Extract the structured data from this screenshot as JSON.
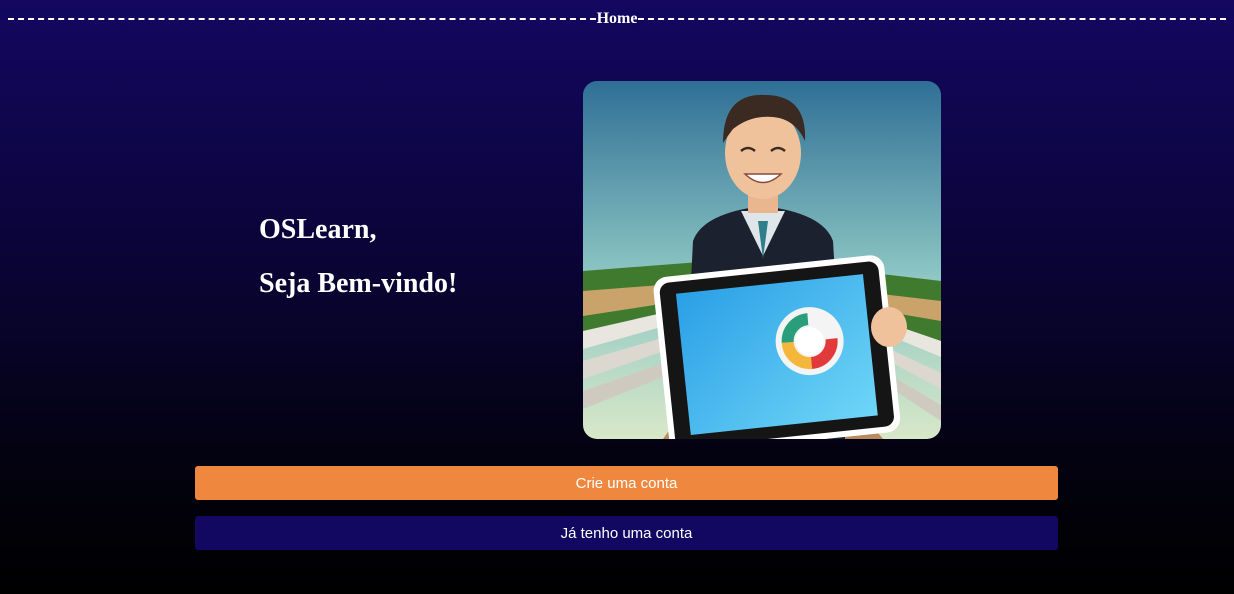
{
  "header": {
    "title": "Home"
  },
  "welcome": {
    "line1": "OSLearn,",
    "line2": "Seja Bem-vindo!"
  },
  "hero": {
    "icon": "hero-illustration-icon",
    "description_subject": "man-holding-tablet"
  },
  "actions": {
    "create_account_label": "Crie uma conta",
    "login_label": "Já tenho uma conta"
  },
  "colors": {
    "background_top": "#130760",
    "background_bottom": "#000000",
    "create_button": "#ef883e",
    "login_button": "#120861",
    "text": "#ffffff"
  }
}
